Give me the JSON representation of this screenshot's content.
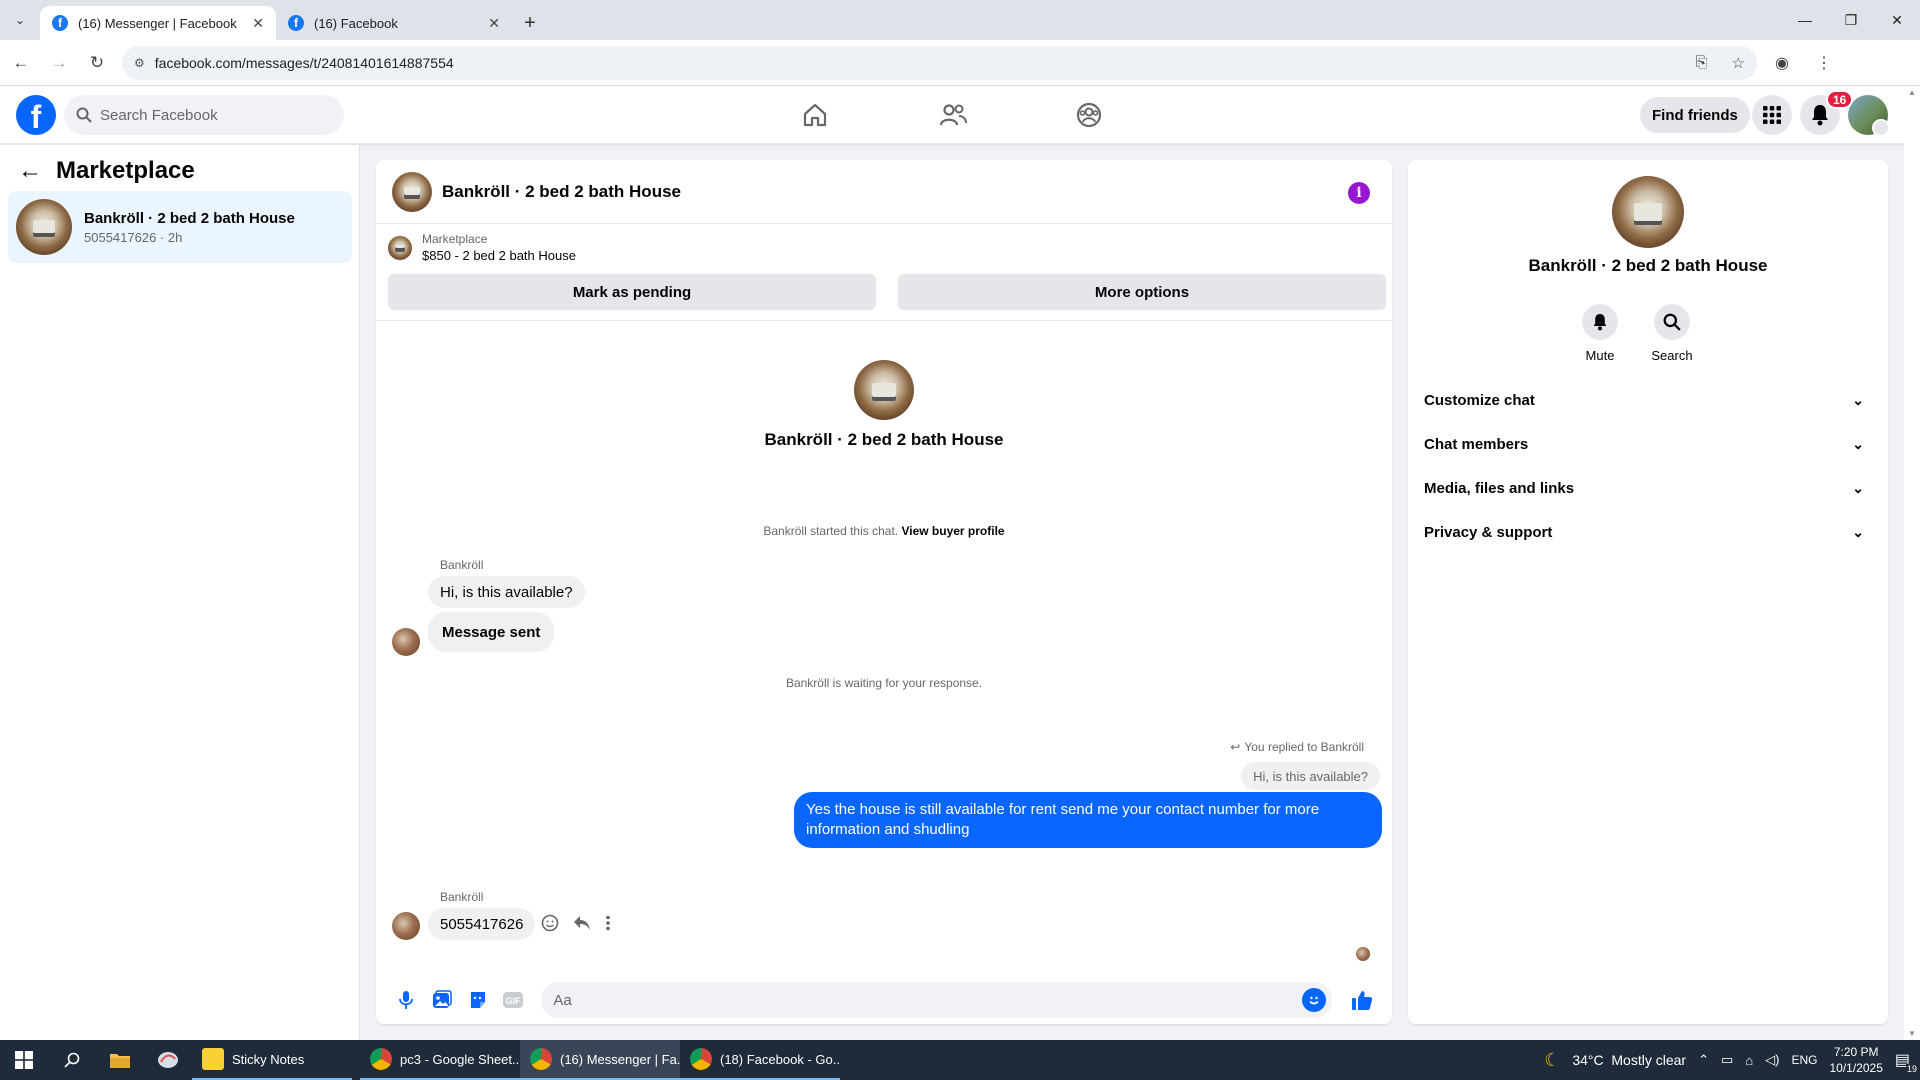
{
  "browser": {
    "tabs": [
      {
        "label": "(16) Messenger | Facebook",
        "active": true
      },
      {
        "label": "(16) Facebook",
        "active": false
      }
    ],
    "url": "facebook.com/messages/t/24081401614887554"
  },
  "header": {
    "search_placeholder": "Search Facebook",
    "find_friends": "Find friends",
    "notification_count": "16"
  },
  "sidebar": {
    "title": "Marketplace",
    "conversation": {
      "title": "Bankröll · 2 bed 2 bath House",
      "subtitle": "5055417626 · 2h"
    }
  },
  "chat": {
    "title": "Bankröll · 2 bed 2 bath House",
    "listing_label": "Marketplace",
    "listing_detail": "$850 - 2 bed 2 bath House",
    "mark_pending": "Mark as pending",
    "more_options": "More options",
    "center_name": "Bankröll · 2 bed 2 bath House",
    "started_text": "Bankröll started this chat.",
    "view_buyer": "View buyer profile",
    "sender_name": "Bankröll",
    "msg1": "Hi, is this available?",
    "msg2": "Message sent",
    "waiting": "Bankröll is waiting for your response.",
    "replied_note": "You replied to Bankröll",
    "quoted": "Hi, is this available?",
    "my_reply": "Yes the house is still available for rent send me your contact number for more information and shudling",
    "sender_name2": "Bankröll",
    "msg3": "5055417626",
    "composer_placeholder": "Aa"
  },
  "info_panel": {
    "name": "Bankröll · 2 bed 2 bath House",
    "mute": "Mute",
    "search": "Search",
    "sections": [
      "Customize chat",
      "Chat members",
      "Media, files and links",
      "Privacy & support"
    ]
  },
  "taskbar": {
    "apps": [
      "Sticky Notes",
      "pc3 - Google Sheet...",
      "(16) Messenger | Fa...",
      "(18) Facebook - Go..."
    ],
    "weather": "34°C  Mostly clear",
    "lang": "ENG",
    "time": "7:20 PM",
    "date": "10/1/2025",
    "notif_count": "19"
  },
  "colors": {
    "brand": "#0866ff",
    "info": "#9a17d1",
    "badge": "#e41e3f"
  }
}
